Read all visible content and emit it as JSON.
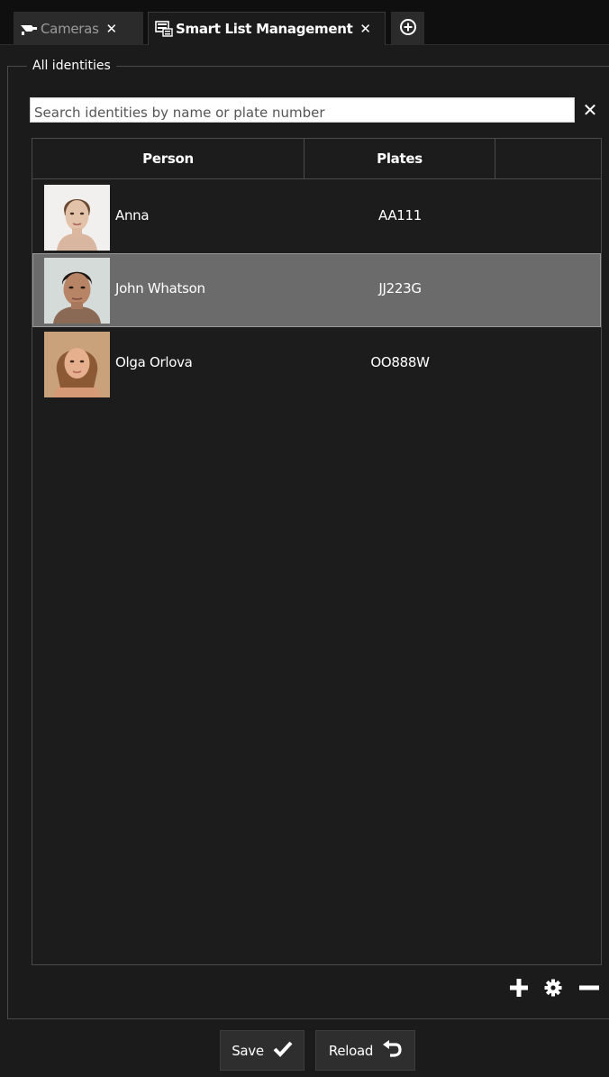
{
  "tabs": [
    {
      "label": "Cameras",
      "icon": "cctv-camera-icon",
      "active": false
    },
    {
      "label": "Smart List Management",
      "icon": "list-monitor-icon",
      "active": true
    }
  ],
  "add_tab_icon": "plus-circle-icon",
  "group": {
    "title": "All identities"
  },
  "search": {
    "placeholder": "Search identities by name or plate number",
    "value": ""
  },
  "table": {
    "columns": [
      "Person",
      "Plates",
      ""
    ],
    "rows": [
      {
        "name": "Anna",
        "plate": "AA111",
        "selected": false
      },
      {
        "name": "John Whatson",
        "plate": "JJ223G",
        "selected": true
      },
      {
        "name": "Olga Orlova",
        "plate": "OO888W",
        "selected": false
      }
    ]
  },
  "toolbar": {
    "add_icon": "plus-icon",
    "settings_icon": "gear-icon",
    "remove_icon": "minus-icon"
  },
  "footer": {
    "save_label": "Save",
    "reload_label": "Reload"
  },
  "colors": {
    "background": "#1b1b1b",
    "selected_row": "#6b6b6b",
    "tab_bar": "#0f0f0f"
  }
}
